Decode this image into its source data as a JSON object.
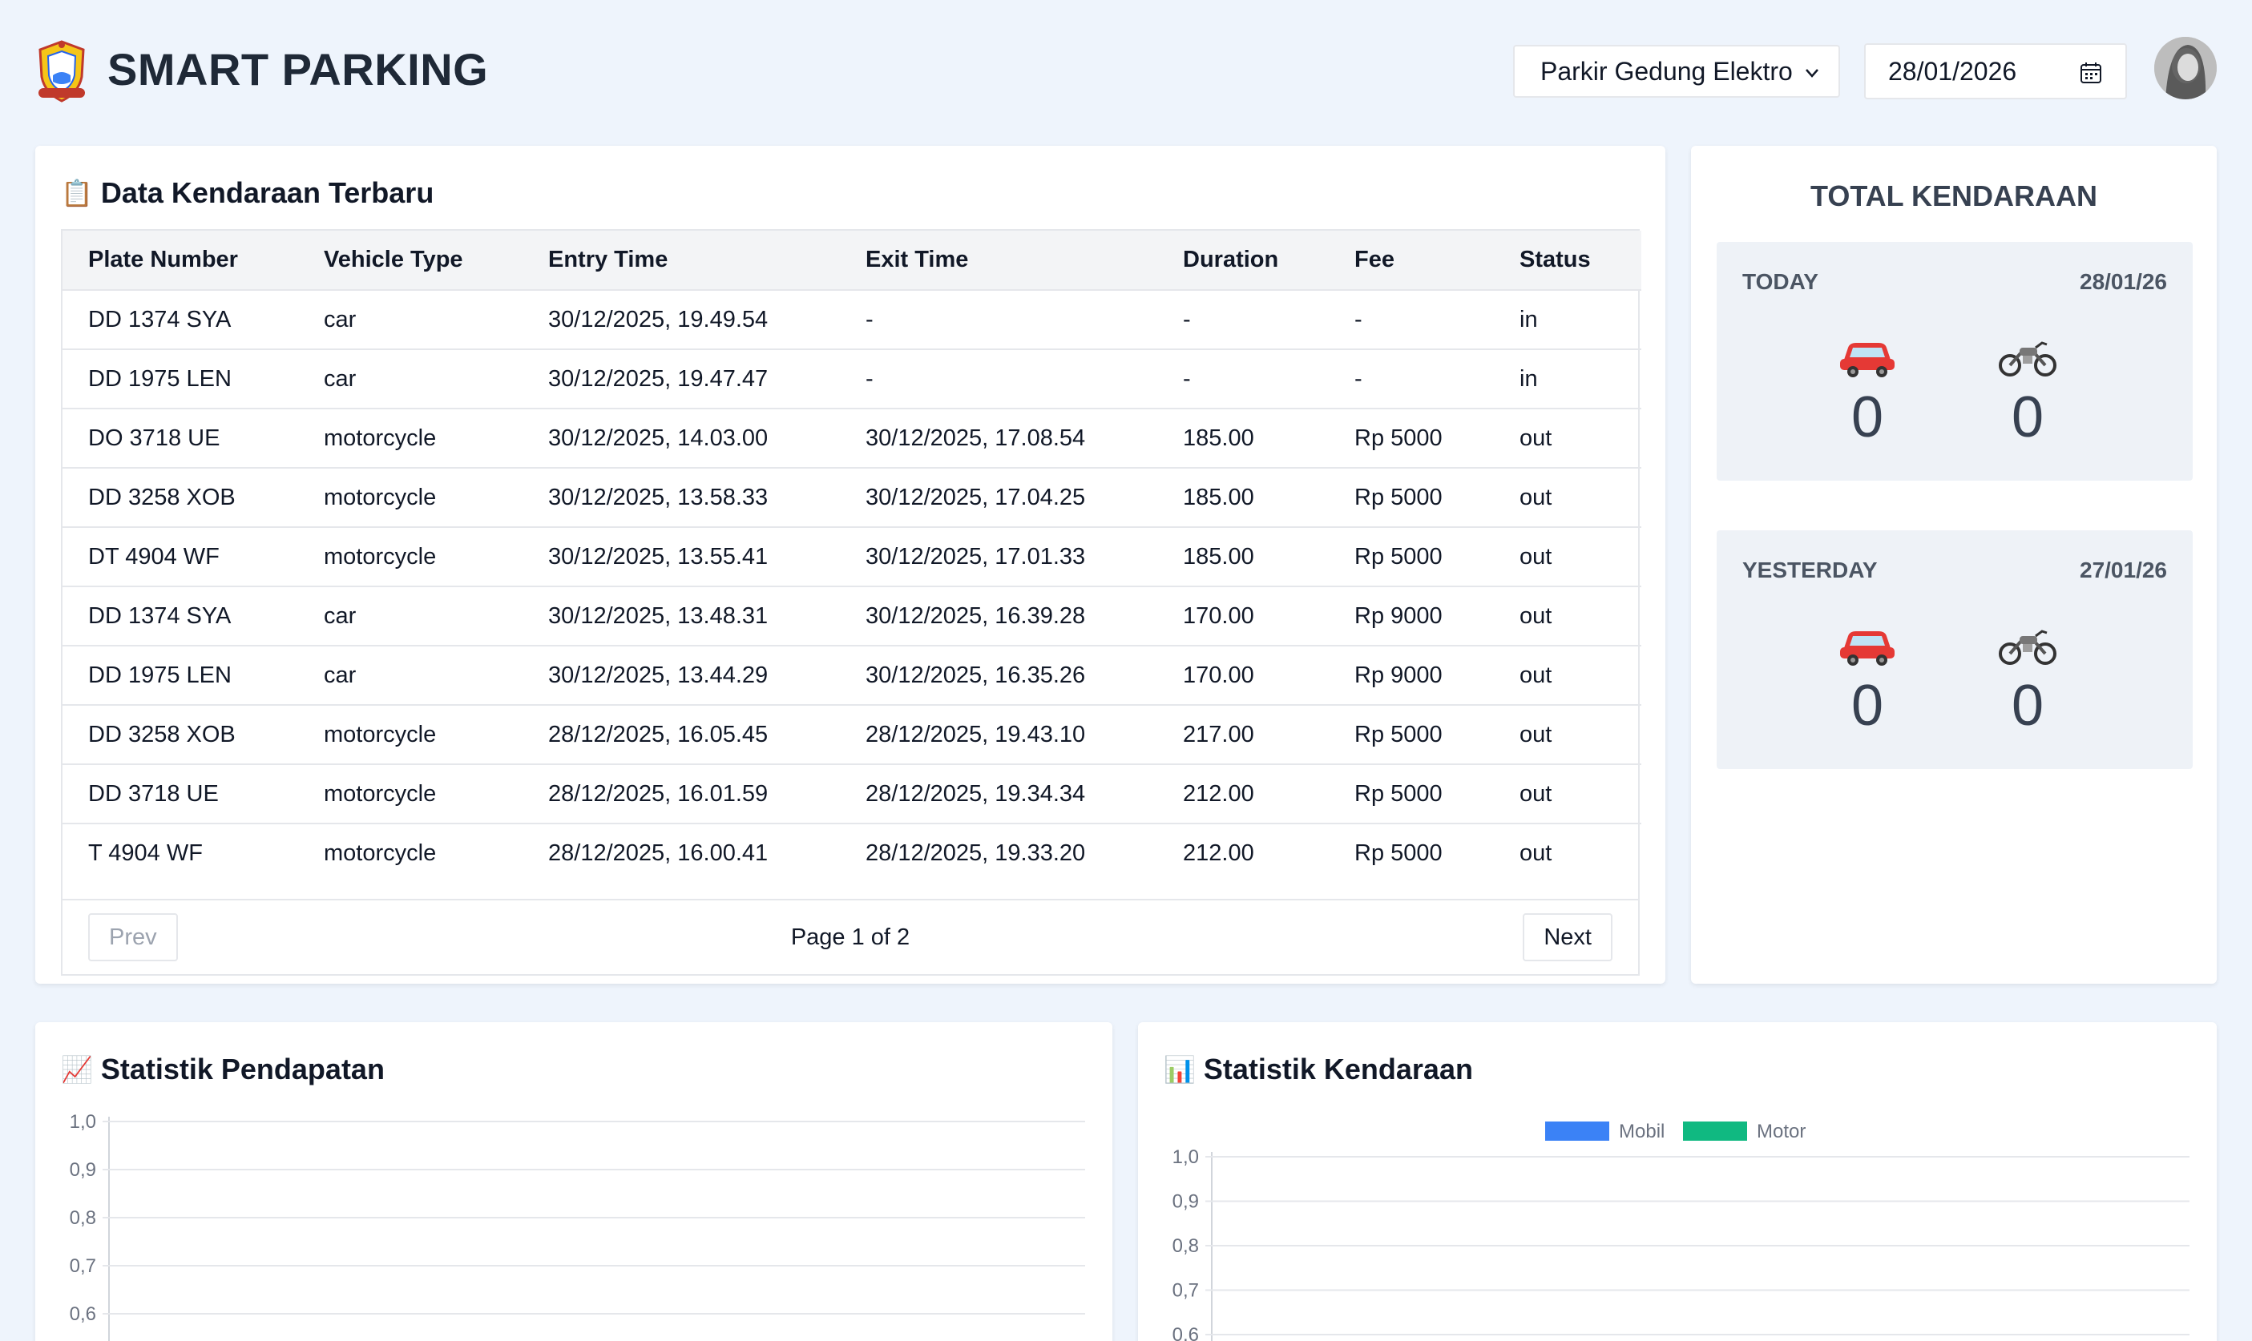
{
  "header": {
    "title": "SMART PARKING",
    "location": "Parkir Gedung Elektro",
    "date": "28/01/2026"
  },
  "recent": {
    "title": "Data Kendaraan Terbaru",
    "columns": [
      "Plate Number",
      "Vehicle Type",
      "Entry Time",
      "Exit Time",
      "Duration",
      "Fee",
      "Status"
    ],
    "rows": [
      [
        "DD 1374 SYA",
        "car",
        "30/12/2025, 19.49.54",
        "-",
        "-",
        "-",
        "in"
      ],
      [
        "DD 1975 LEN",
        "car",
        "30/12/2025, 19.47.47",
        "-",
        "-",
        "-",
        "in"
      ],
      [
        "DO 3718 UE",
        "motorcycle",
        "30/12/2025, 14.03.00",
        "30/12/2025, 17.08.54",
        "185.00",
        "Rp 5000",
        "out"
      ],
      [
        "DD 3258 XOB",
        "motorcycle",
        "30/12/2025, 13.58.33",
        "30/12/2025, 17.04.25",
        "185.00",
        "Rp 5000",
        "out"
      ],
      [
        "DT 4904 WF",
        "motorcycle",
        "30/12/2025, 13.55.41",
        "30/12/2025, 17.01.33",
        "185.00",
        "Rp 5000",
        "out"
      ],
      [
        "DD 1374 SYA",
        "car",
        "30/12/2025, 13.48.31",
        "30/12/2025, 16.39.28",
        "170.00",
        "Rp 9000",
        "out"
      ],
      [
        "DD 1975 LEN",
        "car",
        "30/12/2025, 13.44.29",
        "30/12/2025, 16.35.26",
        "170.00",
        "Rp 9000",
        "out"
      ],
      [
        "DD 3258 XOB",
        "motorcycle",
        "28/12/2025, 16.05.45",
        "28/12/2025, 19.43.10",
        "217.00",
        "Rp 5000",
        "out"
      ],
      [
        "DD 3718 UE",
        "motorcycle",
        "28/12/2025, 16.01.59",
        "28/12/2025, 19.34.34",
        "212.00",
        "Rp 5000",
        "out"
      ],
      [
        "T 4904 WF",
        "motorcycle",
        "28/12/2025, 16.00.41",
        "28/12/2025, 19.33.20",
        "212.00",
        "Rp 5000",
        "out"
      ]
    ],
    "prev_label": "Prev",
    "next_label": "Next",
    "page_info": "Page 1 of 2"
  },
  "total": {
    "title": "TOTAL KENDARAAN",
    "today": {
      "label": "TODAY",
      "date": "28/01/26",
      "cars": "0",
      "motorcycles": "0"
    },
    "yesterday": {
      "label": "YESTERDAY",
      "date": "27/01/26",
      "cars": "0",
      "motorcycles": "0"
    }
  },
  "charts": {
    "revenue_title": "Statistik Pendapatan",
    "vehicle_title": "Statistik Kendaraan"
  },
  "chart_data": [
    {
      "type": "line",
      "title": "Statistik Pendapatan",
      "y_ticks": [
        "1,0",
        "0,9",
        "0,8",
        "0,7",
        "0,6"
      ],
      "ylim": [
        0.6,
        1.0
      ],
      "grid": true,
      "series": []
    },
    {
      "type": "bar",
      "title": "Statistik Kendaraan",
      "y_ticks": [
        "1,0",
        "0,9",
        "0,8",
        "0,7",
        "0,6"
      ],
      "ylim": [
        0.6,
        1.0
      ],
      "grid": true,
      "legend": "top",
      "series": [
        {
          "name": "Mobil",
          "color": "#3b82f6",
          "values": []
        },
        {
          "name": "Motor",
          "color": "#10b981",
          "values": []
        }
      ]
    }
  ],
  "colors": {
    "background": "#eef4fc",
    "mobil": "#3b82f6",
    "motor": "#10b981"
  }
}
